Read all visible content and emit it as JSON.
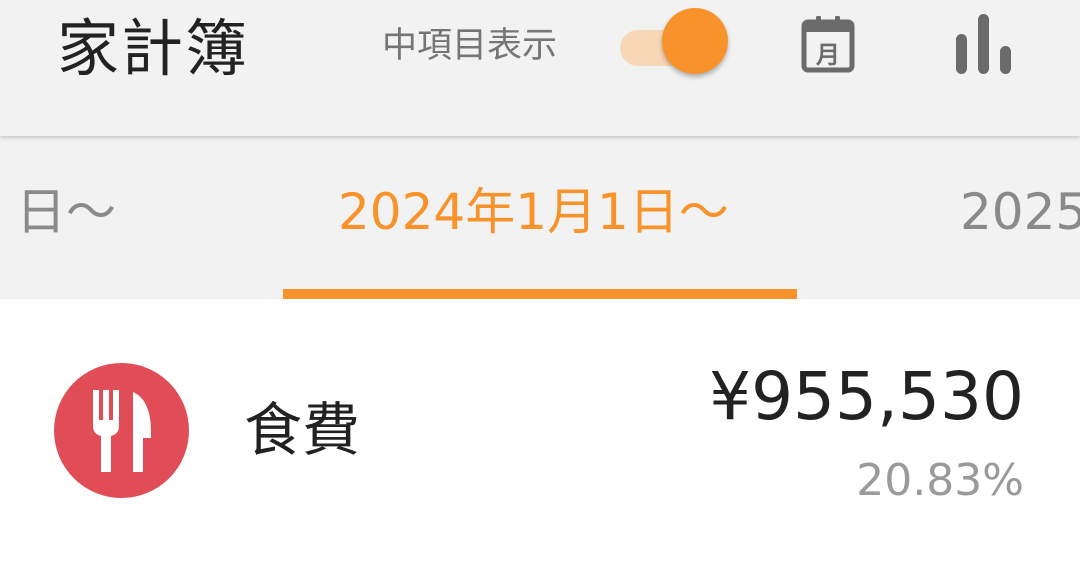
{
  "app": {
    "title": "家計簿"
  },
  "toolbar": {
    "toggle_label": "中項目表示",
    "toggle_on": true,
    "calendar_icon": "calendar-month-icon",
    "calendar_glyph": "月",
    "chart_icon": "bar-chart-icon"
  },
  "tabs": {
    "prev_label": "日〜",
    "current_label": "2024年1月1日〜",
    "next_label": "2025"
  },
  "categories": [
    {
      "name": "食費",
      "amount": "¥955,530",
      "percent": "20.83%",
      "icon": "fork-knife-icon",
      "color": "#e14d56"
    }
  ],
  "colors": {
    "accent": "#f7932a",
    "accent_light": "#f8d7b6",
    "appbar_bg": "#f2f2f2",
    "icon_gray": "#6b6b6b"
  }
}
